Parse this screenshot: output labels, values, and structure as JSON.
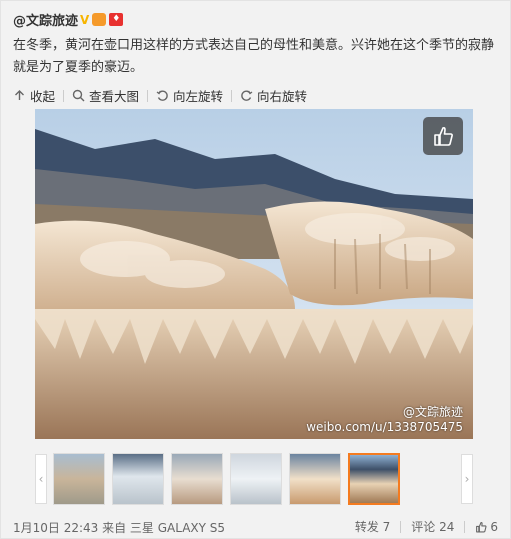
{
  "post": {
    "author": "@文踪旅迹",
    "text": "在冬季，黄河在壶口用这样的方式表达自己的母性和美意。兴许她在这个季节的寂静就是为了夏季的豪迈。"
  },
  "toolbar": {
    "collapse_label": "收起",
    "view_large_label": "查看大图",
    "rotate_left_label": "向左旋转",
    "rotate_right_label": "向右旋转"
  },
  "photo": {
    "watermark_handle": "@文踪旅迹",
    "watermark_url": "weibo.com/u/1338705475"
  },
  "thumbnails": {
    "count": 6,
    "selected_index": 5,
    "prev_arrow": "‹",
    "next_arrow": "›"
  },
  "footer": {
    "meta": "1月10日 22:43 来自 三星 GALAXY S5",
    "repost_label": "转发 7",
    "comment_label": "评论 24",
    "like_count": "6"
  },
  "colors": {
    "accent": "#f47b20",
    "badge_gold": "#f7b500",
    "badge_red": "#e8312f"
  }
}
